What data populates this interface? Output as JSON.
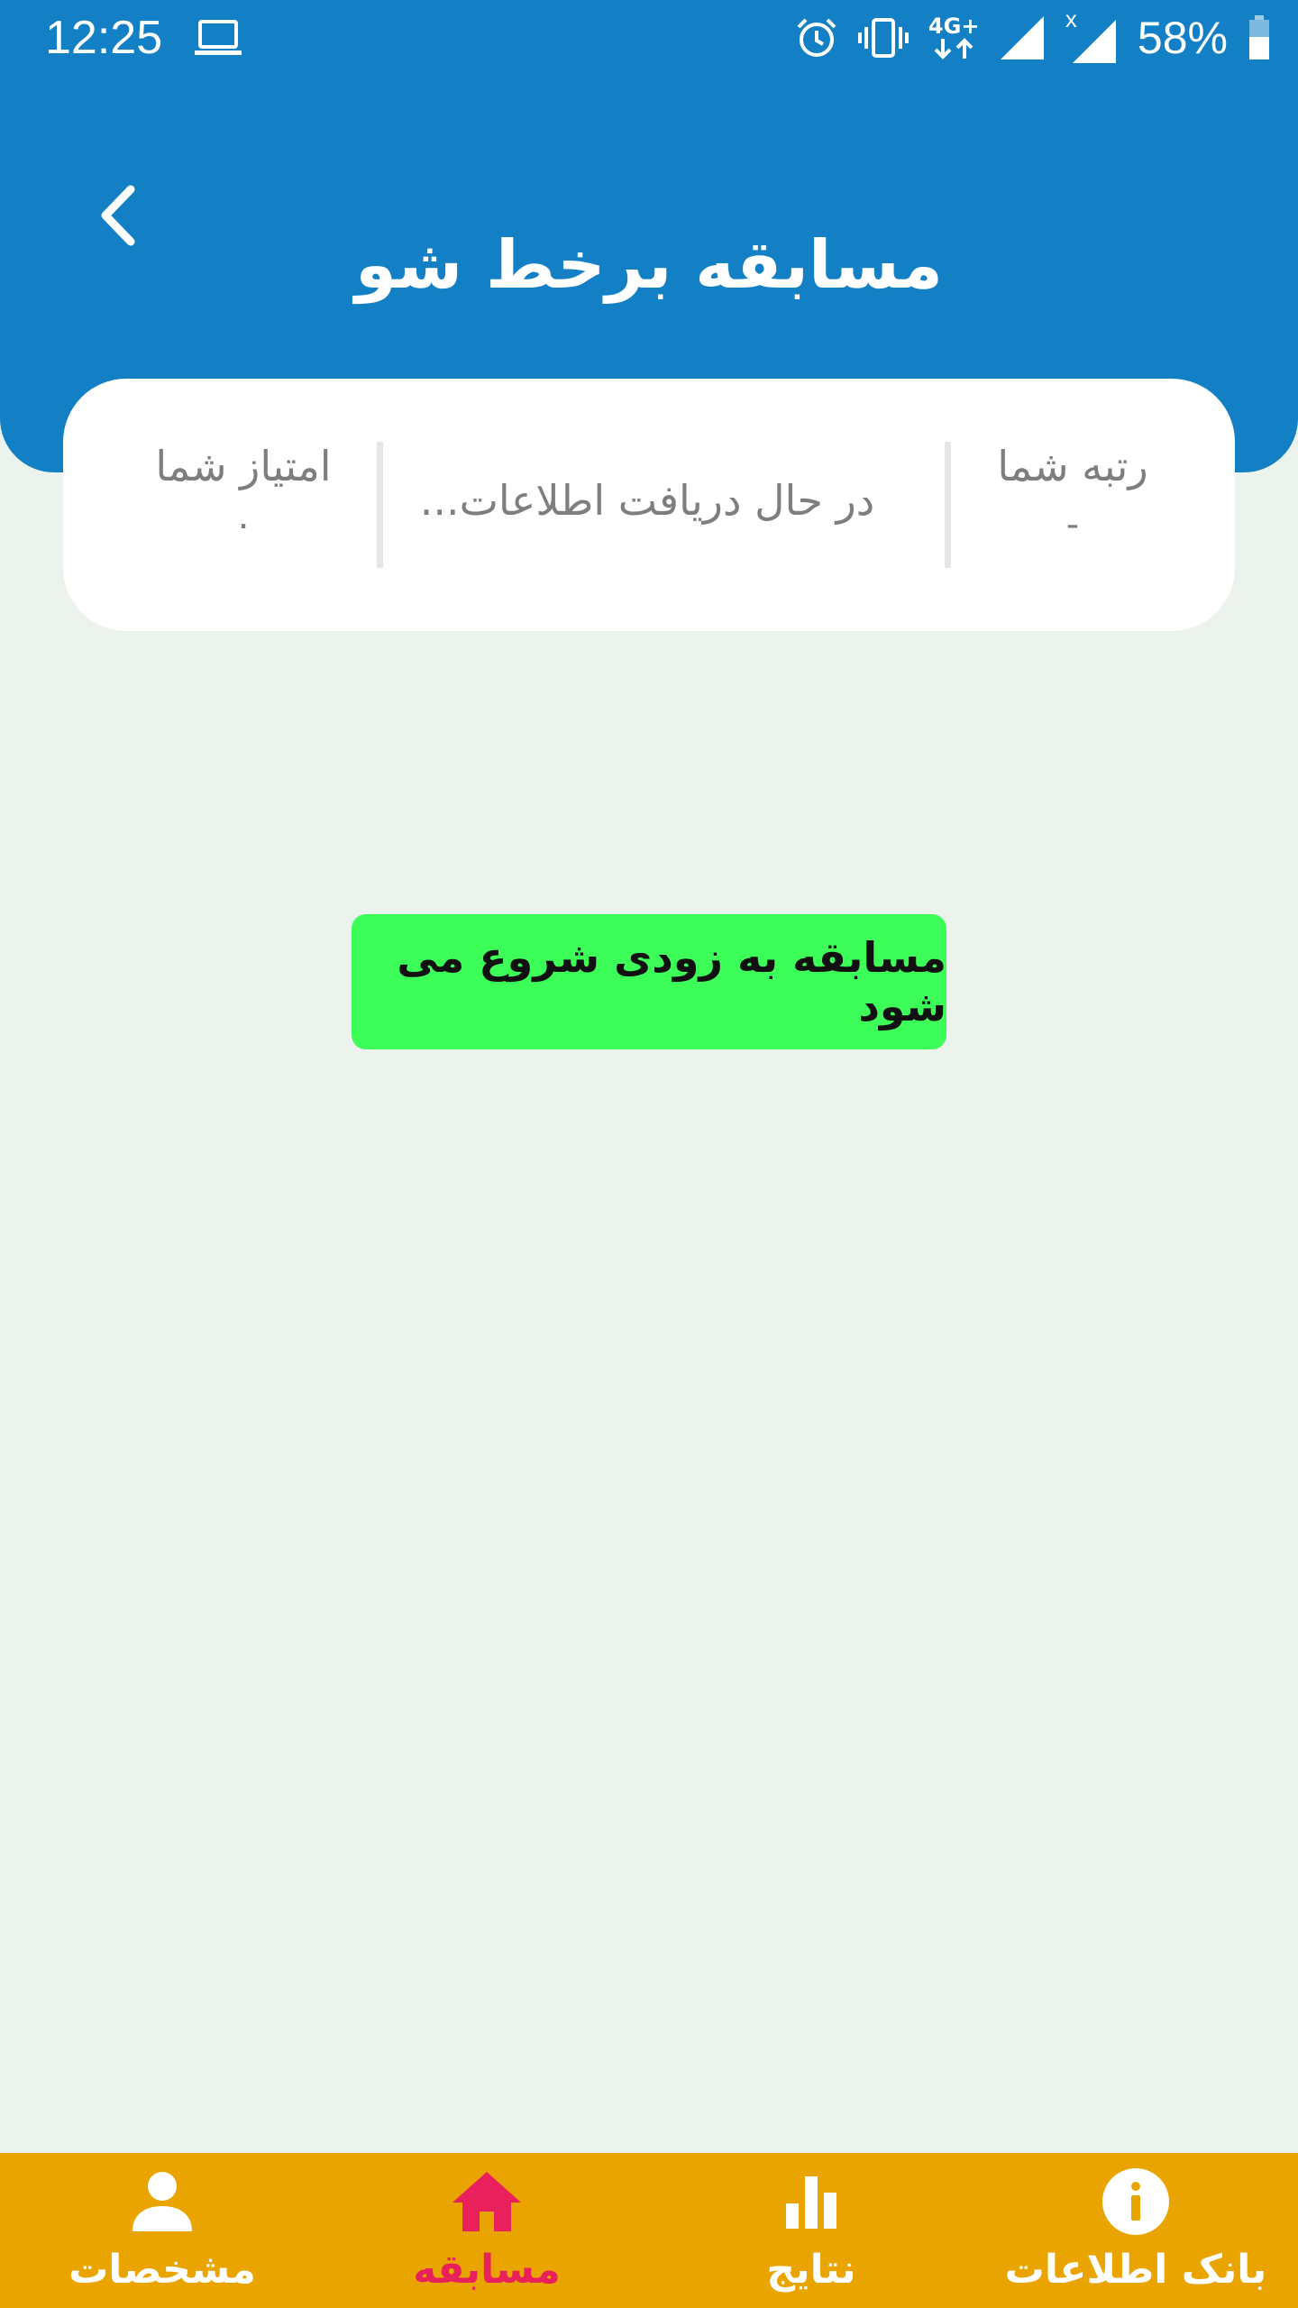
{
  "status_bar": {
    "time": "12:25",
    "network": "4G+",
    "roaming_mark": "x",
    "battery": "58%",
    "icons": [
      "laptop-icon",
      "alarm-icon",
      "vibrate-icon",
      "signal-icon",
      "battery-icon"
    ]
  },
  "header": {
    "title": "مسابقه برخط شو",
    "back_icon": "chevron-left-icon"
  },
  "info_card": {
    "rank_label": "رتبه شما",
    "rank_value": "-",
    "status_text": "در حال دریافت اطلاعات...",
    "score_label": "امتیاز شما",
    "score_value": "۰"
  },
  "main": {
    "start_button_label": "مسابقه به زودی شروع می شود"
  },
  "bottom_nav": {
    "items": [
      {
        "label": "بانک اطلاعات",
        "icon": "info-icon",
        "active": false
      },
      {
        "label": "نتایج",
        "icon": "bar-chart-icon",
        "active": false
      },
      {
        "label": "مسابقه",
        "icon": "home-icon",
        "active": true
      },
      {
        "label": "مشخصات",
        "icon": "person-icon",
        "active": false
      }
    ]
  },
  "colors": {
    "primary": "#1380C6",
    "background": "#ECF2EC",
    "button_green": "#3DFE58",
    "nav_bg": "#EAA400",
    "nav_active": "#E8205C"
  }
}
